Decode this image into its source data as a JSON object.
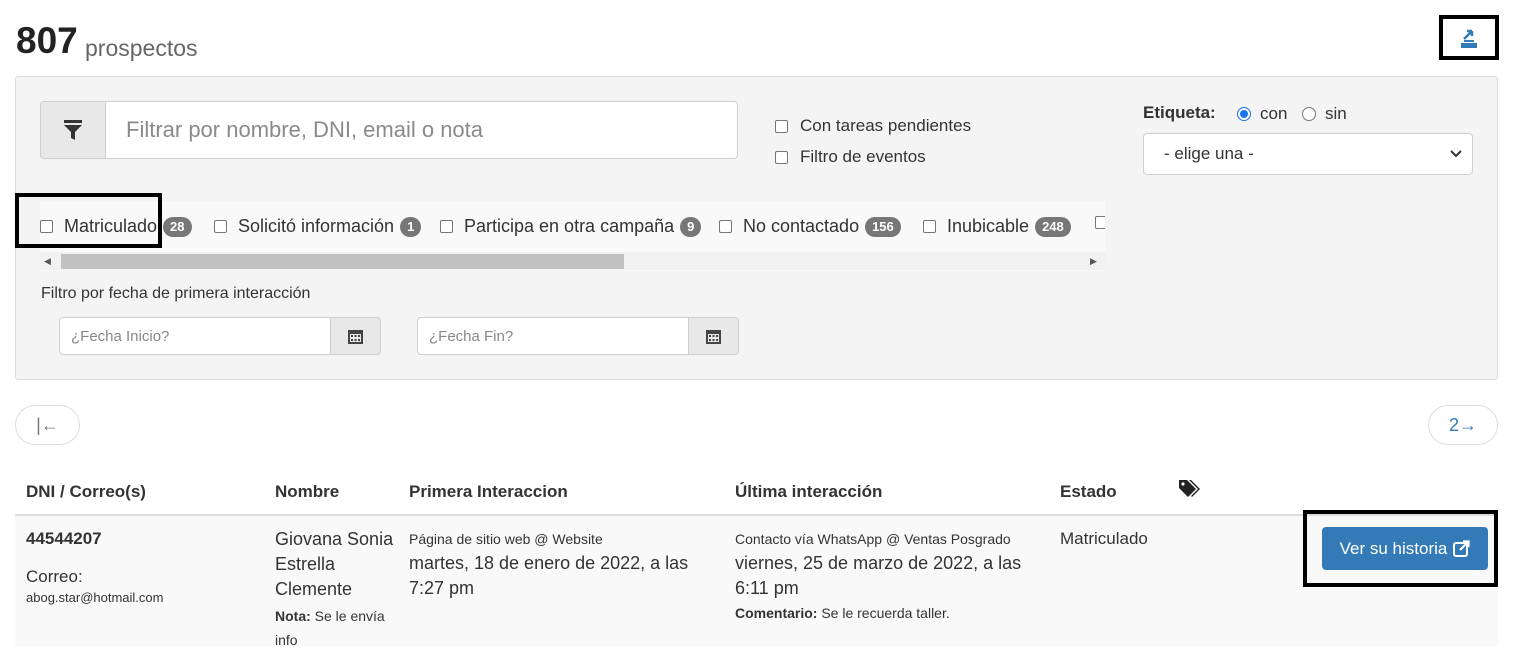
{
  "header": {
    "count": "807",
    "count_label": "prospectos",
    "export_icon": "export-icon"
  },
  "filters": {
    "search_placeholder": "Filtrar por nombre, DNI, email o nota",
    "filter_icon": "funnel-icon",
    "checkbox_tareas": "Con tareas pendientes",
    "checkbox_eventos": "Filtro de eventos",
    "etiqueta_label": "Etiqueta:",
    "radio_con": "con",
    "radio_sin": "sin",
    "radio_selected": "con",
    "etiqueta_select_value": "- elige una -",
    "status_options": [
      {
        "label": "Matriculado",
        "count": "28"
      },
      {
        "label": "Solicitó información",
        "count": "1"
      },
      {
        "label": "Participa en otra campaña",
        "count": "9"
      },
      {
        "label": "No contactado",
        "count": "156"
      },
      {
        "label": "Inubicable",
        "count": "248"
      }
    ],
    "fecha_label": "Filtro por fecha de primera interacción",
    "fecha_inicio_placeholder": "¿Fecha Inicio?",
    "fecha_fin_placeholder": "¿Fecha Fin?"
  },
  "pagination": {
    "first_label": "|←",
    "next_label": "2→"
  },
  "table": {
    "headers": {
      "dni": "DNI / Correo(s)",
      "nombre": "Nombre",
      "primera": "Primera Interaccion",
      "ultima": "Última interacción",
      "estado": "Estado",
      "tags_icon": "tags-icon"
    },
    "rows": [
      {
        "dni": "44544207",
        "correo_label": "Correo:",
        "email": "abog.star@hotmail.com",
        "nombre": "Giovana Sonia Estrella Clemente",
        "nota_label": "Nota:",
        "nota": "Se le envía info",
        "primera_canal": "Página de sitio web @ Website",
        "primera_fecha": "martes, 18 de enero de 2022, a las 7:27 pm",
        "ultima_canal": "Contacto vía WhatsApp @ Ventas Posgrado",
        "ultima_fecha": "viernes, 25 de marzo de 2022, a las 6:11 pm",
        "comentario_label": "Comentario:",
        "comentario": "Se le recuerda taller.",
        "estado": "Matriculado",
        "action_label": "Ver su historia"
      }
    ]
  },
  "colors": {
    "primary": "#337ab7",
    "badge": "#777777",
    "panel": "#f4f4f4"
  }
}
